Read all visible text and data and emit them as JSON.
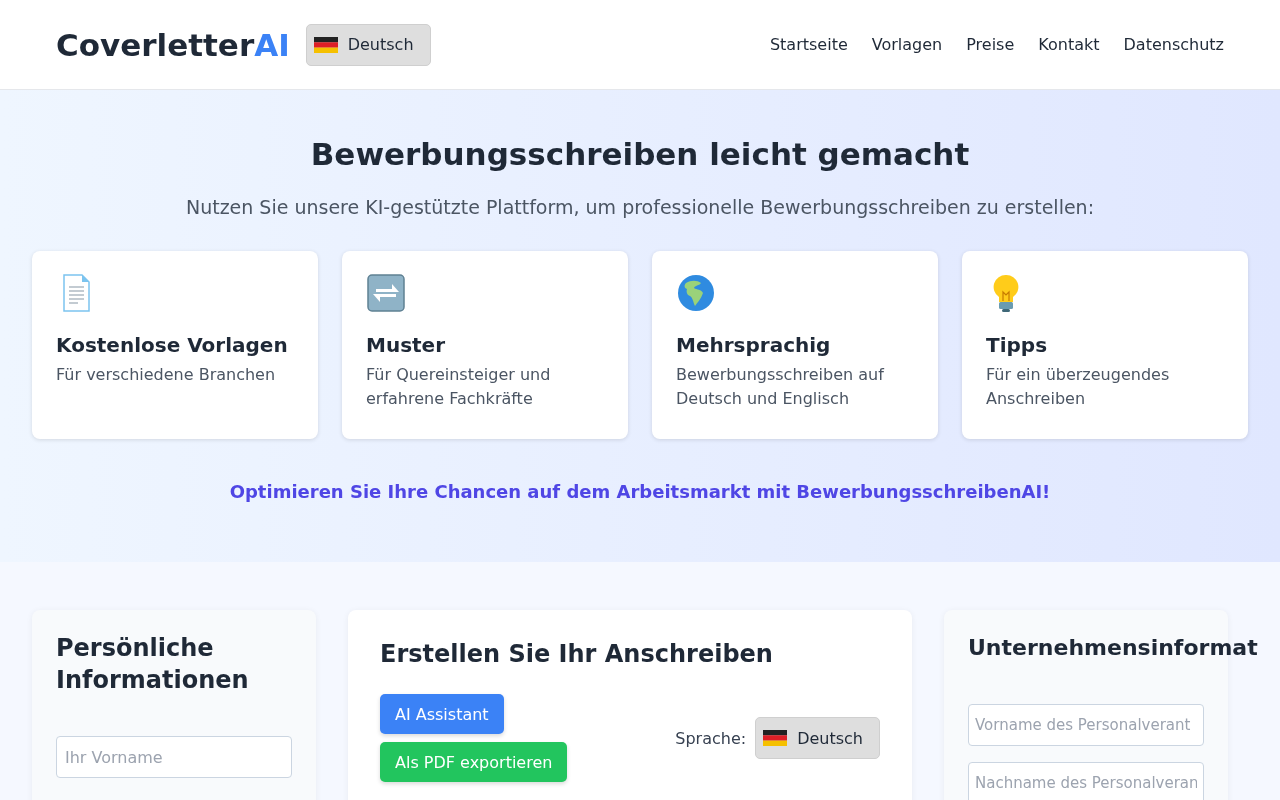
{
  "header": {
    "logo": {
      "main": "Coverletter",
      "accent": "AI"
    },
    "language_button": "Deutsch",
    "nav": [
      "Startseite",
      "Vorlagen",
      "Preise",
      "Kontakt",
      "Datenschutz"
    ]
  },
  "hero": {
    "title": "Bewerbungsschreiben leicht gemacht",
    "subtitle": "Nutzen Sie unsere KI-gestützte Plattform, um professionelle Bewerbungsschreiben zu erstellen:",
    "features": [
      {
        "title": "Kostenlose Vorlagen",
        "text": "Für verschiedene Branchen"
      },
      {
        "title": "Muster",
        "text": "Für Quereinsteiger und erfahrene Fachkräfte"
      },
      {
        "title": "Mehrsprachig",
        "text": "Bewerbungsschreiben auf Deutsch und Englisch"
      },
      {
        "title": "Tipps",
        "text": "Für ein überzeugendes Anschreiben"
      }
    ],
    "tagline": "Optimieren Sie Ihre Chancen auf dem Arbeitsmarkt mit BewerbungsschreibenAI!"
  },
  "personal_panel": {
    "title": "Persönliche Informationen",
    "fields": [
      {
        "placeholder": "Ihr Vorname"
      }
    ]
  },
  "editor_panel": {
    "title": "Erstellen Sie Ihr Anschreiben",
    "buttons": [
      {
        "label": "AI Assistant",
        "kind": "primary"
      },
      {
        "label": "Als PDF exportieren",
        "kind": "success"
      }
    ],
    "language_label": "Sprache:",
    "language_button": "Deutsch"
  },
  "company_panel": {
    "title": "Unternehmensinformat",
    "fields": [
      {
        "placeholder": "Vorname des Personalverant"
      },
      {
        "placeholder": "Nachname des Personalveran"
      }
    ]
  }
}
